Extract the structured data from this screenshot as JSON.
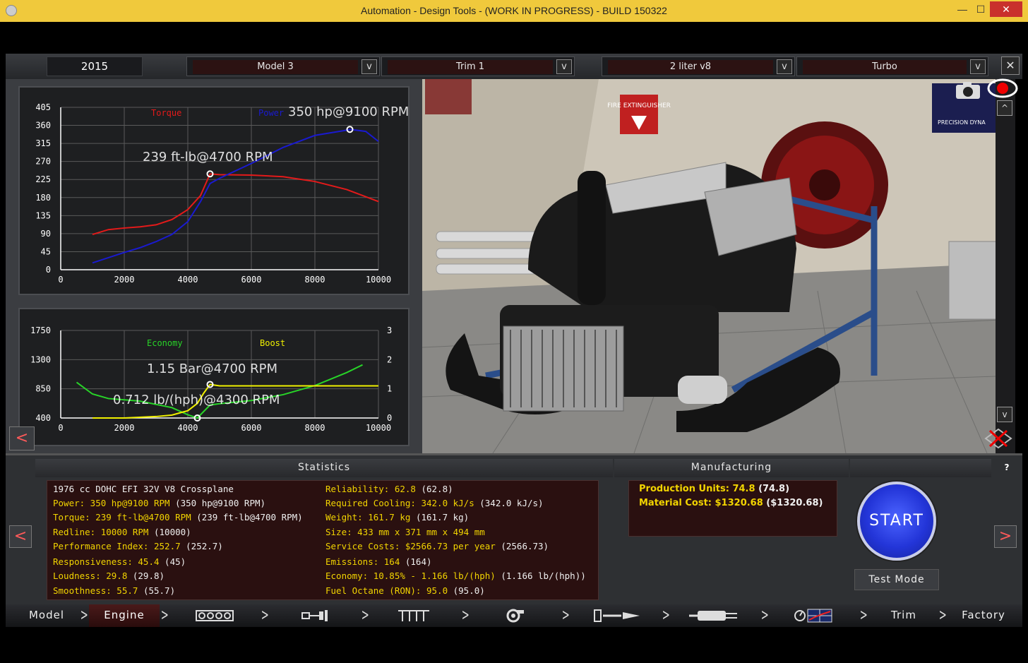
{
  "window": {
    "title": "Automation - Design Tools - (WORK IN PROGRESS) - BUILD 150322",
    "minimize": "—",
    "maximize": "☐",
    "close": "✕"
  },
  "selectors": {
    "year": "2015",
    "model": "Model 3",
    "trim": "Trim 1",
    "engine": "2 liter v8",
    "variant": "Turbo",
    "dropdown_glyph": "v",
    "close_glyph": "✕"
  },
  "chart_nav": {
    "prev": "<"
  },
  "scene_controls": {
    "up": "^",
    "down": "v"
  },
  "chart_data": [
    {
      "type": "line",
      "series": [
        {
          "name": "Torque",
          "color": "#e41a1a",
          "x": [
            1000,
            1500,
            2000,
            2500,
            3000,
            3500,
            4000,
            4400,
            4700,
            5000,
            6000,
            7000,
            8000,
            9000,
            10000
          ],
          "y": [
            88,
            100,
            104,
            107,
            112,
            125,
            150,
            185,
            239,
            237,
            236,
            232,
            220,
            200,
            170
          ]
        },
        {
          "name": "Power",
          "color": "#1a1ad0",
          "x": [
            1000,
            1500,
            2000,
            2500,
            3000,
            3500,
            4000,
            4400,
            4700,
            5000,
            6000,
            7000,
            8000,
            9000,
            9100,
            9600,
            10000
          ],
          "y": [
            17,
            30,
            43,
            55,
            70,
            88,
            120,
            170,
            215,
            228,
            265,
            305,
            335,
            348,
            350,
            345,
            320
          ]
        }
      ],
      "annotations": [
        {
          "text": "350 hp@9100 RPM",
          "x": 9100,
          "y": 350
        },
        {
          "text": "239 ft-lb@4700 RPM",
          "x": 4700,
          "y": 239
        }
      ],
      "xticks": [
        0,
        2000,
        4000,
        6000,
        8000,
        10000
      ],
      "yticks": [
        0,
        45,
        90,
        135,
        180,
        225,
        270,
        315,
        360,
        405
      ],
      "xlim": [
        0,
        10000
      ],
      "ylim": [
        0,
        405
      ],
      "grid": true
    },
    {
      "type": "line",
      "series": [
        {
          "name": "Economy",
          "color": "#28d428",
          "axis": "left",
          "x": [
            500,
            1000,
            1500,
            2000,
            2500,
            3000,
            3500,
            4000,
            4300,
            4700,
            5000,
            6000,
            7000,
            8000,
            9000,
            9500
          ],
          "y": [
            950,
            770,
            700,
            680,
            660,
            610,
            560,
            450,
            400,
            600,
            620,
            670,
            760,
            900,
            1100,
            1220
          ]
        },
        {
          "name": "Boost",
          "color": "#f0f000",
          "axis": "right",
          "x": [
            1000,
            2000,
            3000,
            3500,
            4000,
            4300,
            4500,
            4700,
            5000,
            6000,
            7000,
            8000,
            9000,
            10000
          ],
          "y": [
            0,
            0,
            0.05,
            0.1,
            0.25,
            0.5,
            0.85,
            1.15,
            1.1,
            1.1,
            1.1,
            1.1,
            1.1,
            1.1
          ]
        }
      ],
      "annotations": [
        {
          "text": "1.15 Bar@4700 RPM",
          "x": 4700,
          "y": 1.15
        },
        {
          "text": "0.712 lb/(hph)@4300 RPM",
          "x": 4300,
          "y": 400
        }
      ],
      "xticks": [
        0,
        2000,
        4000,
        6000,
        8000,
        10000
      ],
      "yticks_left": [
        400,
        850,
        1300,
        1750
      ],
      "yticks_right": [
        0,
        1,
        2,
        3
      ],
      "xlim": [
        0,
        10000
      ],
      "ylim": [
        400,
        1750
      ],
      "ylim_right": [
        0,
        3
      ],
      "grid": true
    }
  ],
  "statistics": {
    "header": "Statistics",
    "left": [
      {
        "label": "1976 cc DOHC EFI 32V V8 Crossplane",
        "value": ""
      },
      {
        "label": "Power: 350 hp@9100 RPM",
        "value": " (350 hp@9100 RPM)"
      },
      {
        "label": "Torque: 239 ft-lb@4700 RPM",
        "value": " (239 ft-lb@4700 RPM)"
      },
      {
        "label": "Redline: 10000 RPM",
        "value": " (10000)"
      },
      {
        "label": "Performance Index: 252.7",
        "value": " (252.7)"
      },
      {
        "label": "Responsiveness: 45.4",
        "value": " (45)"
      },
      {
        "label": "Loudness: 29.8",
        "value": " (29.8)"
      },
      {
        "label": "Smoothness: 55.7",
        "value": " (55.7)"
      }
    ],
    "right": [
      {
        "label": "Reliability: 62.8",
        "value": " (62.8)"
      },
      {
        "label": "Required Cooling: 342.0 kJ/s",
        "value": " (342.0 kJ/s)"
      },
      {
        "label": "Weight: 161.7 kg",
        "value": " (161.7 kg)"
      },
      {
        "label": "Size: 433 mm x 371 mm x 494 mm",
        "value": ""
      },
      {
        "label": "Service Costs: $2566.73 per year",
        "value": " (2566.73)"
      },
      {
        "label": "Emissions: 164",
        "value": " (164)"
      },
      {
        "label": "Economy: 10.85% - 1.166 lb/(hph)",
        "value": " (1.166 lb/(hph))"
      },
      {
        "label": "Fuel Octane (RON): 95.0",
        "value": " (95.0)"
      }
    ]
  },
  "manufacturing": {
    "header": "Manufacturing",
    "rows": [
      {
        "label": "Production Units: 74.8",
        "value": " (74.8)"
      },
      {
        "label": "Material Cost: $1320.68",
        "value": " ($1320.68)"
      }
    ]
  },
  "actions": {
    "start": "START",
    "test_mode": "Test Mode",
    "help": "?",
    "prev": "<",
    "next": ">"
  },
  "nav": {
    "items": [
      "Model",
      "Engine",
      "Trim",
      "Factory"
    ],
    "active": "Engine",
    "chevron": ">"
  },
  "scene": {
    "sign_text": "FIRE EXTINGUISHER",
    "banner_text": "PRECISION DYNA"
  }
}
